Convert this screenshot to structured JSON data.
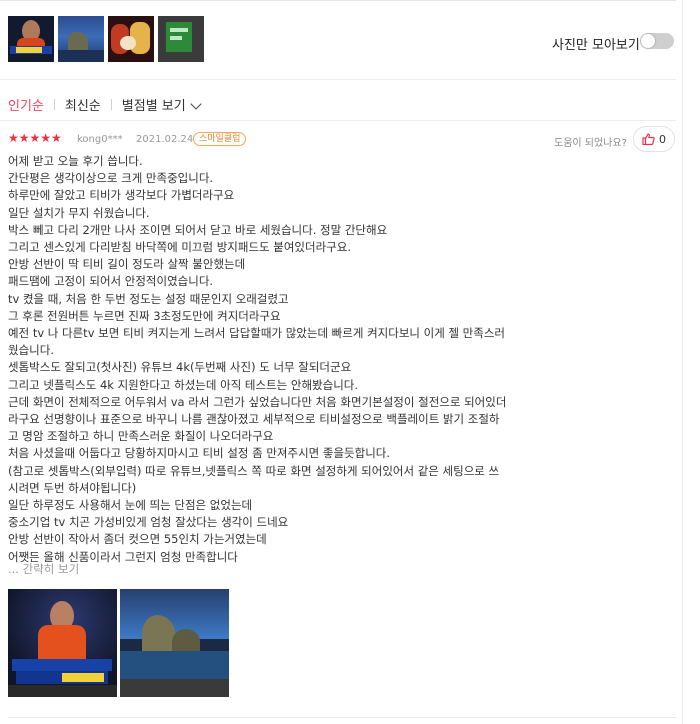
{
  "photo_toggle": {
    "label": "사진만 모아보기",
    "on": false
  },
  "sort_tabs": {
    "popular": "인기순",
    "latest": "최신순",
    "by_rating": "별점별 보기"
  },
  "review": {
    "stars": "★★★★★",
    "rating": 5,
    "reviewer": "kong0***",
    "date": "2021.02.24",
    "badge": "스마일클럽",
    "helpful_question": "도움이 되었나요?",
    "helpful_count": "0",
    "body_lines": [
      "어제 받고 오늘 후기 씁니다.",
      "간단평은 생각이상으로 크게 만족중입니다.",
      "하루만에 잘았고 티비가 생각보다 가볍더라구요",
      "일단 설치가 무지 쉬웠습니다.",
      "박스 뻬고 다리 2개만 나사 조이면 되어서 닫고 바로 세웠습니다. 정말 간단해요",
      "그리고 센스있게 다리받침 바닥쪽에 미끄럼 방지패드도 붙여있더라구요.",
      "안방 선반이 딱 티비 길이 정도라 살짝 불안했는데",
      "패드땜에 고정이 되어서 안정적이였습니다.",
      "tv 켰을 때, 처음 한 두번 정도는 설정 때문인지 오래걸렸고",
      "그 후론 전원버튼 누르면 진짜 3초정도만에 켜지더라구요",
      "예전 tv 나 다른tv 보면 티비 켜지는게 느려서 답답할때가 많았는데 빠르게 켜지다보니 이게 젤 만족스러",
      "웠습니다.",
      "셋톱박스도 잘되고(첫사진) 유튜브 4k(두번째 사진) 도 너무 잘되더군요",
      "그리고 넷플릭스도 4k 지원한다고 하셨는데 아직 테스트는 안해봤습니다.",
      "근데 화면이 전체적으로 어두워서 va 라서 그런가 싶었습니다만 처음 화면기본설정이 절전으로 되어있더",
      "라구요 선명향이나 표준으로 바꾸니 나름 괜찮아졌고 세부적으로 티비설정으로 백플레이트 밝기 조절하",
      "고 명암 조절하고 하니 만족스러운 화질이 나오더라구요",
      "처음 사셨을때 어둡다고 당황하지마시고 티비 설정 좀 만져주시면 좋을듯합니다.",
      "(참고로 셋톱박스(외부입력) 따로 유튜브,넷플릭스 쪽 따로 화면 설정하게 되어있어서 같은 세팅으로 쓰",
      "시려면 두번 하셔야됩니다)",
      "일단 하루정도 사용해서 눈에 띄는 단점은 없었는데",
      "중소기업 tv 치곤 가성비있게 엄청 잘샀다는 생각이 드네요",
      "안방 선반이 작아서 좀더 컷으면 55인치 가는거였는데",
      "어쨋든 올해 신품이라서 그런지 엄청 만족합니다"
    ],
    "collapse_link": "... 간략히 보기"
  },
  "colors": {
    "accent": "#ff3d55",
    "stars": "#f0303f",
    "badge": "#e08a2e"
  },
  "icons": {
    "toggle": "toggle-switch-icon",
    "chevron": "chevron-down-icon",
    "thumb": "thumbs-up-icon"
  }
}
